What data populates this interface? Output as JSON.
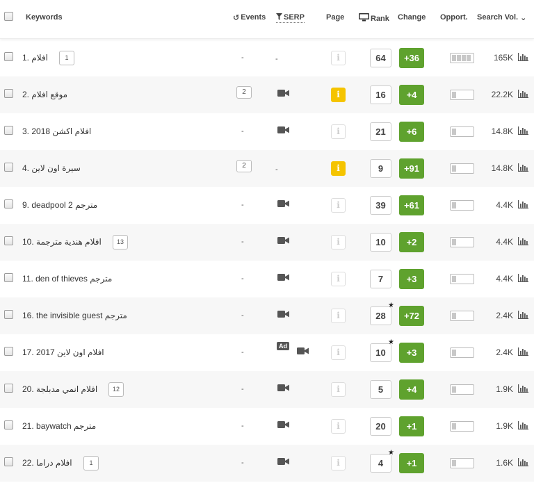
{
  "header": {
    "keywords": "Keywords",
    "events": "Events",
    "serp": "SERP",
    "page": "Page",
    "rank": "Rank",
    "change": "Change",
    "opport": "Opport.",
    "search_vol": "Search Vol."
  },
  "colors": {
    "change_bg": "#5fa22e",
    "page_active": "#f5c400"
  },
  "rows": [
    {
      "keyword": "1.  افلام",
      "kw_badge": "1",
      "events": "-",
      "events_badge": "",
      "serp": "dash",
      "page_active": false,
      "page": "i",
      "rank": "64",
      "star": "",
      "change": "+36",
      "opport_level": 4,
      "vol": "165K"
    },
    {
      "keyword": "2.  موقع افلام",
      "kw_badge": "",
      "events": "",
      "events_badge": "2",
      "serp": "video",
      "page_active": true,
      "page": "i",
      "rank": "16",
      "star": "",
      "change": "+4",
      "opport_level": 1,
      "vol": "22.2K"
    },
    {
      "keyword": "3.  افلام اكشن 2018",
      "kw_badge": "",
      "events": "-",
      "events_badge": "",
      "serp": "video",
      "page_active": false,
      "page": "i",
      "rank": "21",
      "star": "",
      "change": "+6",
      "opport_level": 1,
      "vol": "14.8K"
    },
    {
      "keyword": "4.  سيرة اون لاين",
      "kw_badge": "",
      "events": "",
      "events_badge": "2",
      "serp": "dash",
      "page_active": true,
      "page": "i",
      "rank": "9",
      "star": "",
      "change": "+91",
      "opport_level": 1,
      "vol": "14.8K"
    },
    {
      "keyword": "9.  deadpool 2 مترجم",
      "kw_badge": "",
      "events": "-",
      "events_badge": "",
      "serp": "video",
      "page_active": false,
      "page": "i",
      "rank": "39",
      "star": "",
      "change": "+61",
      "opport_level": 1,
      "vol": "4.4K"
    },
    {
      "keyword": "10.  افلام هندية مترجمة",
      "kw_badge": "13",
      "events": "-",
      "events_badge": "",
      "serp": "video",
      "page_active": false,
      "page": "i",
      "rank": "10",
      "star": "",
      "change": "+2",
      "opport_level": 1,
      "vol": "4.4K"
    },
    {
      "keyword": "11.  den of thieves مترجم",
      "kw_badge": "",
      "events": "-",
      "events_badge": "",
      "serp": "video",
      "page_active": false,
      "page": "i",
      "rank": "7",
      "star": "",
      "change": "+3",
      "opport_level": 1,
      "vol": "4.4K"
    },
    {
      "keyword": "16.  the invisible guest مترجم",
      "kw_badge": "",
      "events": "-",
      "events_badge": "",
      "serp": "video",
      "page_active": false,
      "page": "i",
      "rank": "28",
      "star": "★",
      "change": "+72",
      "opport_level": 1,
      "vol": "2.4K"
    },
    {
      "keyword": "17.  افلام اون لاين 2017",
      "kw_badge": "",
      "events": "-",
      "events_badge": "",
      "serp": "ad-video",
      "ad_label": "Ad",
      "page_active": false,
      "page": "i",
      "rank": "10",
      "star": "★",
      "change": "+3",
      "opport_level": 1,
      "vol": "2.4K"
    },
    {
      "keyword": "20.  افلام انمي مدبلجة",
      "kw_badge": "12",
      "events": "-",
      "events_badge": "",
      "serp": "video",
      "page_active": false,
      "page": "i",
      "rank": "5",
      "star": "",
      "change": "+4",
      "opport_level": 1,
      "vol": "1.9K"
    },
    {
      "keyword": "21.  baywatch مترجم",
      "kw_badge": "",
      "events": "-",
      "events_badge": "",
      "serp": "video",
      "page_active": false,
      "page": "i",
      "rank": "20",
      "star": "",
      "change": "+1",
      "opport_level": 1,
      "vol": "1.9K"
    },
    {
      "keyword": "22.  افلام دراما",
      "kw_badge": "1",
      "events": "-",
      "events_badge": "",
      "serp": "video",
      "page_active": false,
      "page": "i",
      "rank": "4",
      "star": "★",
      "change": "+1",
      "opport_level": 1,
      "vol": "1.6K"
    }
  ]
}
